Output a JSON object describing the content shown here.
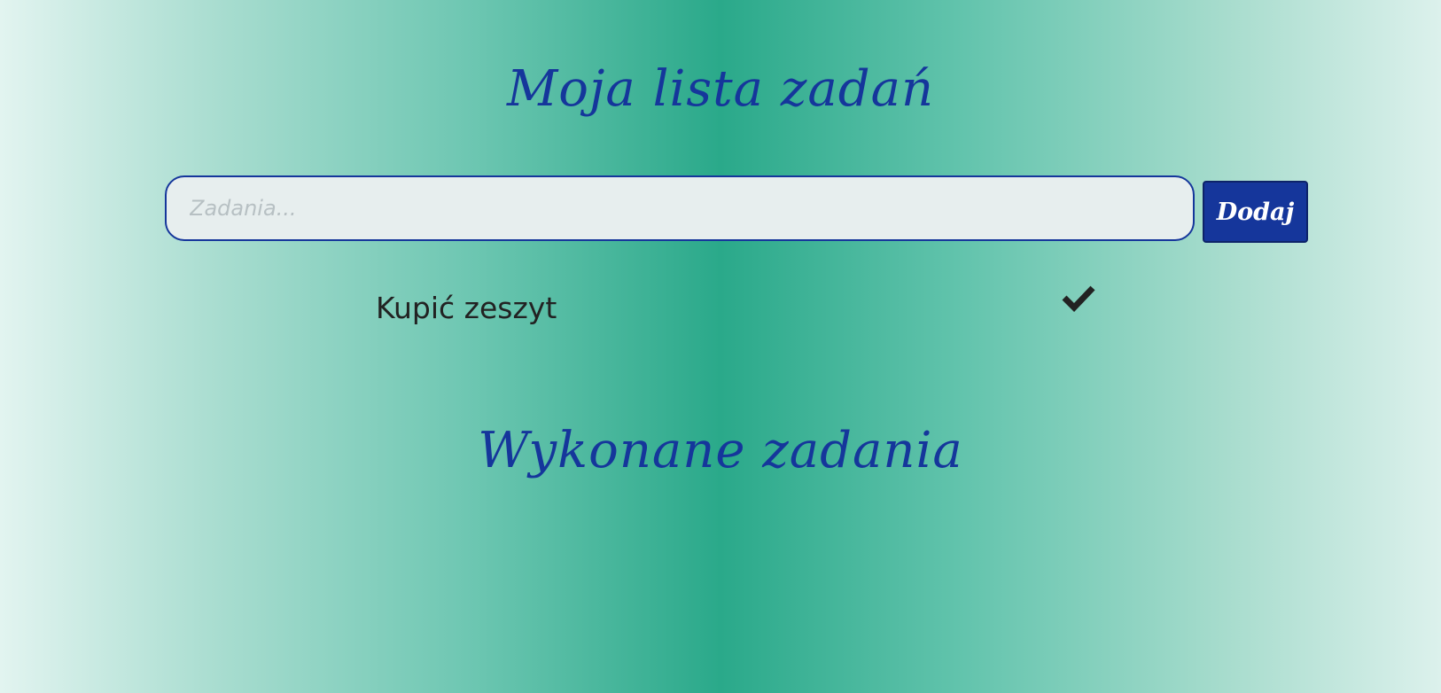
{
  "header": {
    "title": "Moja lista zadań"
  },
  "form": {
    "input_value": "",
    "input_placeholder": "Zadania...",
    "add_label": "Dodaj"
  },
  "tasks": [
    {
      "text": "Kupić zeszyt",
      "icon": "check-icon"
    }
  ],
  "done_section": {
    "title": "Wykonane zadania",
    "items": []
  },
  "colors": {
    "accent": "#15369b",
    "gradient_center": "#2aa98a",
    "gradient_edge": "#e2f4f0",
    "text": "#222222"
  }
}
